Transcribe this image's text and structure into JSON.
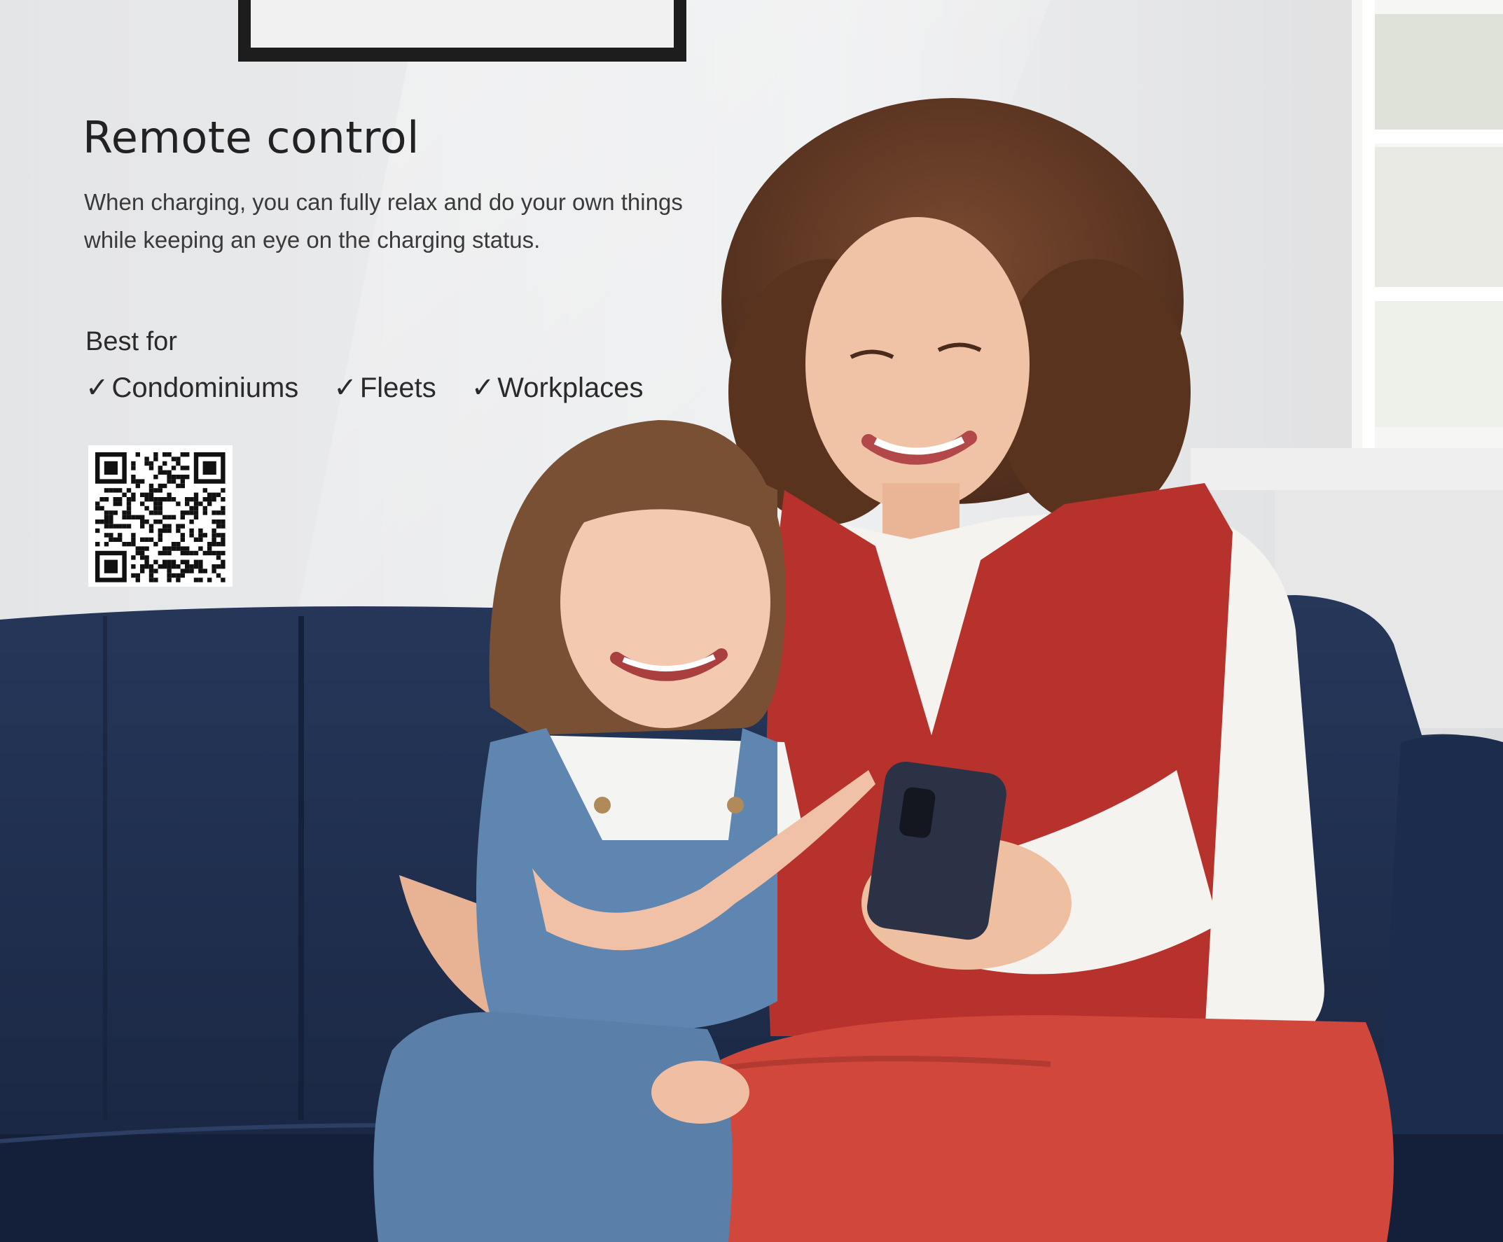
{
  "hero": {
    "title": "Remote control",
    "description": "When charging, you can fully relax and do your own things while keeping an eye on the charging status."
  },
  "best_for": {
    "label": "Best for",
    "check_icon": "check-icon",
    "items": [
      {
        "label": "Condominiums"
      },
      {
        "label": "Fleets"
      },
      {
        "label": "Workplaces"
      }
    ]
  },
  "qr": {
    "icon": "qr-code-icon"
  },
  "colors": {
    "wall": "#e9eaeb",
    "sofa": "#1f2f4f",
    "vest": "#b7322d",
    "text": "#2a2a2a"
  }
}
